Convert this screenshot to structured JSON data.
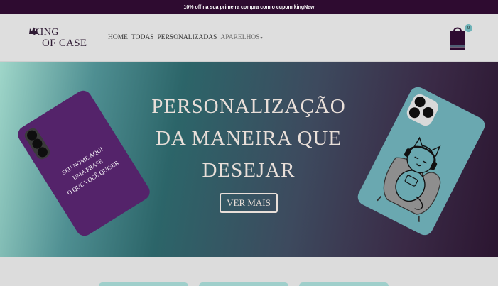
{
  "promo": {
    "text": "10% off na sua primeira compra com o cupom kingNew"
  },
  "header": {
    "logo": {
      "line1": "KING",
      "line2": "OF CASE",
      "icon": "crown-icon"
    },
    "nav": [
      {
        "label": "HOME"
      },
      {
        "label": "TODAS"
      },
      {
        "label": "PERSONALIZADAS"
      },
      {
        "label": "APARELHOS"
      }
    ],
    "cart": {
      "icon": "shopping-bag-icon",
      "count": "0"
    }
  },
  "hero": {
    "title_lines": [
      "PERSONALIZAÇÃO",
      "DA MANEIRA QUE",
      "DESEJAR"
    ],
    "cta": "VER MAIS",
    "left_case": {
      "lines": [
        "SEU NOME AQUI",
        "UMA FRASE",
        "O QUE VOCÊ QUISER"
      ]
    },
    "right_case": {
      "art": "cat-with-headphones-illustration"
    }
  },
  "colors": {
    "promo_bg": "#2e0b30",
    "brand_dark": "#2e1a33",
    "accent_teal": "#6fb3b8",
    "case_purple": "#54236a",
    "case_teal": "#6aa8b0",
    "hero_text": "#e9dfd9"
  }
}
